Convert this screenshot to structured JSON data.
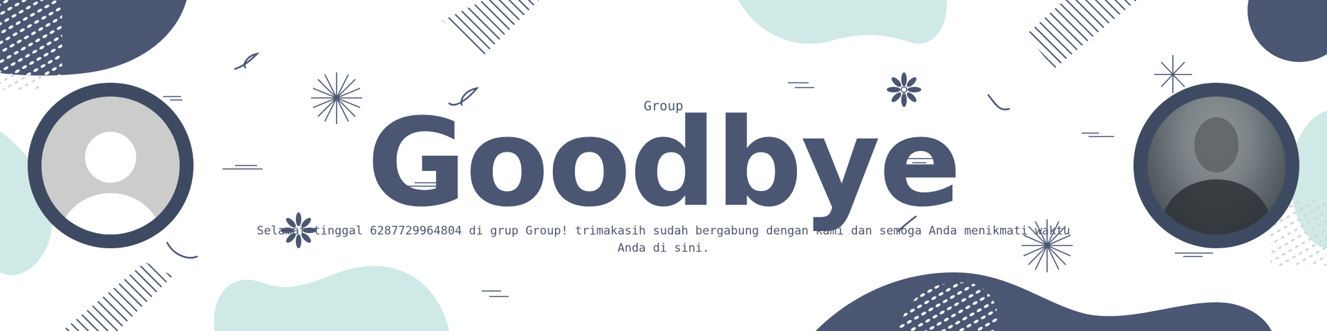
{
  "card": {
    "group_name": "Group",
    "title": "Goodbye",
    "message": "Selamat tinggal 6287729964804 di grup Group! trimakasih sudah bergabung dengan kami dan semoga Anda menikmati waktu Anda di sini."
  },
  "avatars": {
    "left": {
      "icon": "default-user-icon"
    },
    "right": {
      "icon": "member-photo"
    }
  },
  "colors": {
    "navy": "#4a5672",
    "avatar_ring": "#3d4a62",
    "mint": "#cfeae6",
    "placeholder_gray": "#cccccc"
  }
}
